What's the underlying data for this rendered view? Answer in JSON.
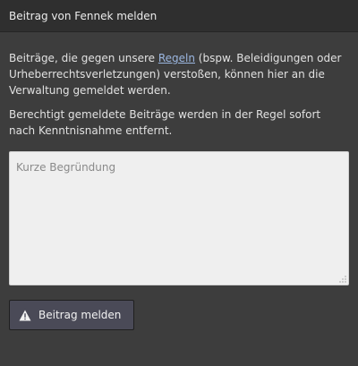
{
  "dialog": {
    "title": "Beitrag von Fennek melden"
  },
  "intro": {
    "before_link": "Beiträge, die gegen unsere ",
    "link_text": "Regeln",
    "after_link": " (bspw. Beleidigungen oder Urheberrechtsverletzungen) verstoßen, können hier an die Verwaltung gemeldet werden."
  },
  "notice": "Berechtigt gemeldete Beiträge werden in der Regel sofort nach Kenntnisnahme entfernt.",
  "reason_field": {
    "value": "",
    "placeholder": "Kurze Begründung"
  },
  "submit": {
    "label": "Beitrag melden",
    "icon": "warning-icon"
  },
  "colors": {
    "background": "#3d3d3d",
    "header": "#2f2f2f",
    "link": "#9bb6e0",
    "button": "#4a4a57"
  }
}
